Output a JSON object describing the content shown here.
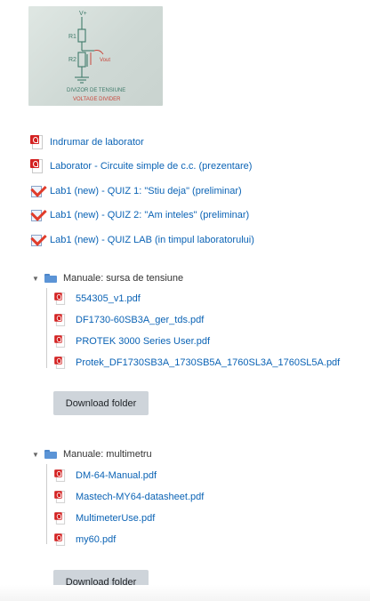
{
  "image": {
    "name": "voltage-divider-whiteboard",
    "handwritten_text": [
      "V+",
      "R1",
      "R2",
      "Vout",
      "DIVIZOR DE TENSIUNE",
      "VOLTAGE DIVIDER"
    ]
  },
  "activities": [
    {
      "icon": "pdf-icon",
      "label": "Indrumar de laborator"
    },
    {
      "icon": "pdf-icon",
      "label": "Laborator - Circuite simple de c.c. (prezentare)"
    },
    {
      "icon": "quiz-icon",
      "label": "Lab1 (new) - QUIZ 1: \"Stiu deja\" (preliminar)"
    },
    {
      "icon": "quiz-icon",
      "label": "Lab1 (new) - QUIZ 2: \"Am inteles\" (preliminar)"
    },
    {
      "icon": "quiz-icon",
      "label": "Lab1 (new) - QUIZ LAB (in timpul laboratorului)"
    }
  ],
  "folders": [
    {
      "name": "Manuale: sursa de tensiune",
      "files": [
        "554305_v1.pdf",
        "DF1730-60SB3A_ger_tds.pdf",
        "PROTEK 3000 Series User.pdf",
        "Protek_DF1730SB3A_1730SB5A_1760SL3A_1760SL5A.pdf"
      ],
      "button": "Download folder"
    },
    {
      "name": "Manuale: multimetru",
      "files": [
        "DM-64-Manual.pdf",
        "Mastech-MY64-datasheet.pdf",
        "MultimeterUse.pdf",
        "my60.pdf"
      ],
      "button": "Download folder"
    }
  ],
  "colors": {
    "link": "#0b63b5",
    "button_bg": "#ced4da",
    "folder": "#5b94d6",
    "pdf": "#d42222"
  }
}
